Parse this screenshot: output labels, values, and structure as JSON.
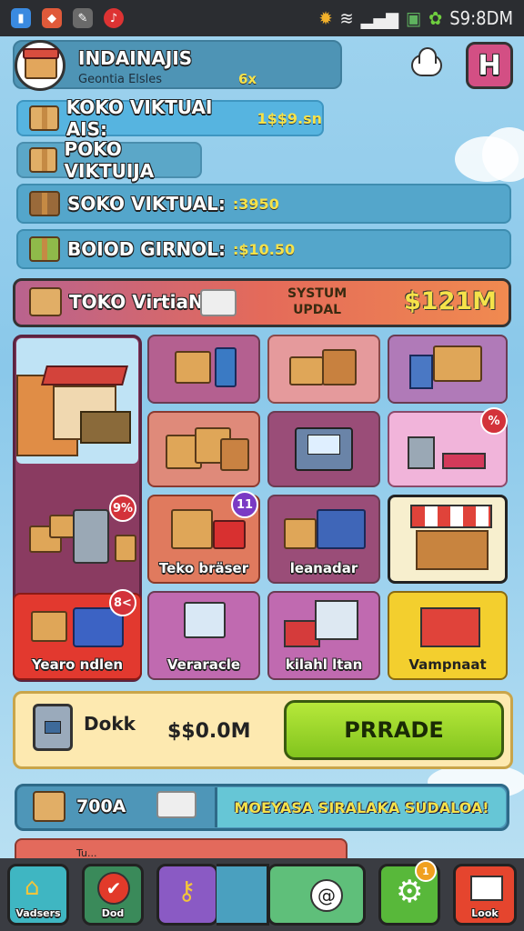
{
  "status_bar": {
    "time": "S9:8DM"
  },
  "header": {
    "title": "INDAINAJIS",
    "subtitle": "Geontia Elsles",
    "multiplier": "6x"
  },
  "top_right": {
    "h_button": "H"
  },
  "rows": [
    {
      "label": "KOKO VIKTUAI AIS:",
      "value": "1$$9.sn"
    },
    {
      "label": "POKO VIKTUIJA",
      "value": ""
    },
    {
      "label": "SOKO VIKTUAL:",
      "value": ":3950"
    },
    {
      "label": "BOIOD GIRNOL:",
      "value": ":$10.50"
    }
  ],
  "banner": {
    "label": "TOKO VirtiaN",
    "system_line1": "SYSTUM",
    "system_line2": "UPDAL",
    "value": "$121M"
  },
  "tiles": {
    "badge_left": "9%",
    "badge_mid": "11",
    "badge_right": "%",
    "badge_bottom_left": "8<",
    "teko_label": "Teko bräser",
    "leanadar_label": "leanadar",
    "yearo_label": "Yearo ndlen",
    "veraracle_label": "Veraracle",
    "kilahl_label": "kilahl ltan",
    "vampnaat_label": "Vampnaat"
  },
  "trade_panel": {
    "label": "Dokk",
    "value": "$$0.0M",
    "button": "PRRADE"
  },
  "bottom_banner": {
    "label": "700A",
    "message": "MOEYASA SIRALAKA SUDALOA!"
  },
  "partial_row": {
    "label": "Tu..."
  },
  "nav": {
    "n1": "Vadsers",
    "n2": "Dod",
    "n3": "",
    "n4": "",
    "n5": "",
    "n6": "Look",
    "badge": "1"
  },
  "colors": {
    "accent_green": "#8fcc2a",
    "banner_red": "#e46a5a",
    "tile_purple": "#a35a8a"
  }
}
